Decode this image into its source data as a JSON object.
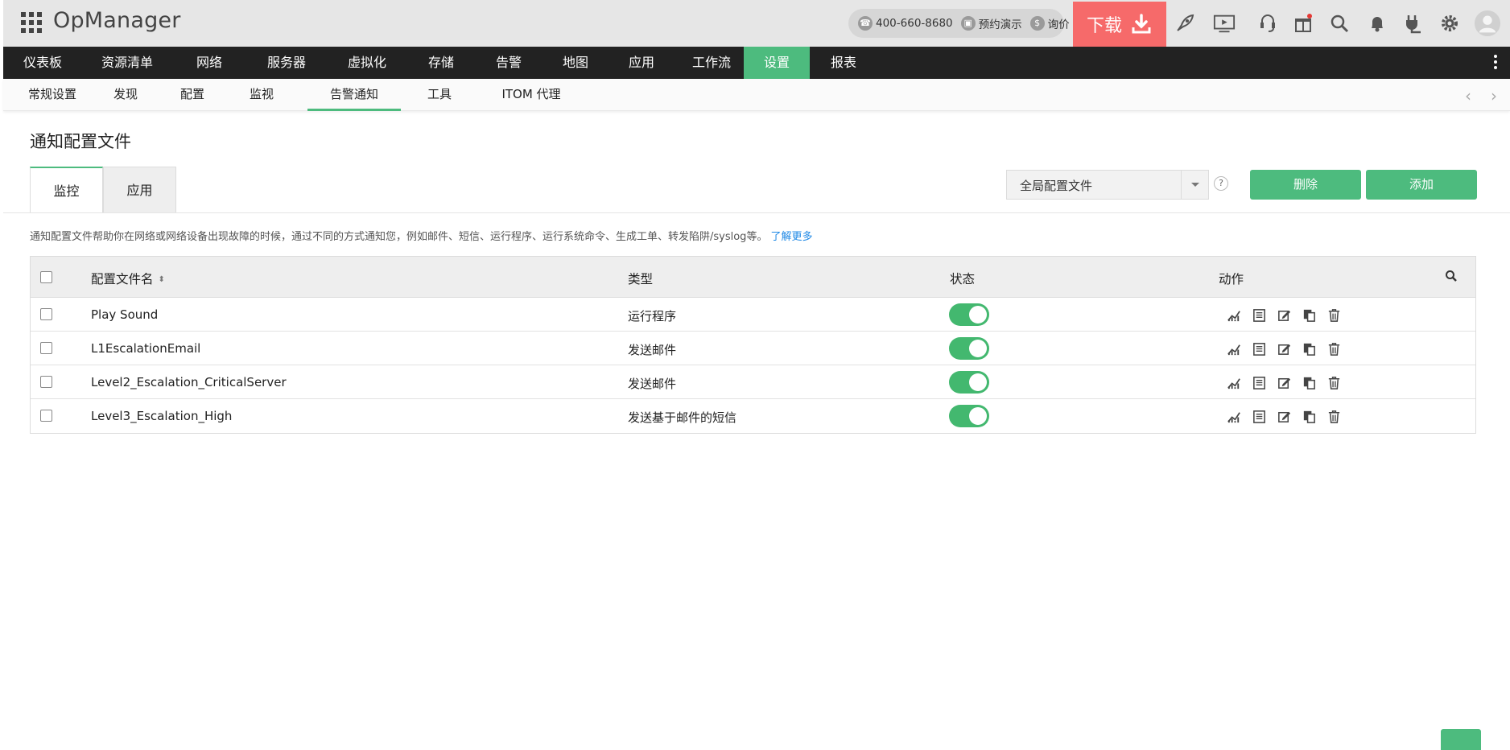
{
  "header": {
    "app_name": "OpManager",
    "phone": "400-660-8680",
    "demo_label": "预约演示",
    "quote_label": "询价",
    "download_label": "下载",
    "icons": [
      "rocket-icon",
      "presentation-icon",
      "support-icon",
      "gift-icon",
      "search-icon",
      "bell-icon",
      "plug-icon",
      "gear-icon",
      "user-avatar-icon"
    ]
  },
  "main_nav": {
    "items": [
      {
        "label": "仪表板"
      },
      {
        "label": "资源清单"
      },
      {
        "label": "网络"
      },
      {
        "label": "服务器"
      },
      {
        "label": "虚拟化"
      },
      {
        "label": "存储"
      },
      {
        "label": "告警"
      },
      {
        "label": "地图"
      },
      {
        "label": "应用"
      },
      {
        "label": "工作流"
      },
      {
        "label": "设置"
      },
      {
        "label": "报表"
      }
    ],
    "active_index": 10
  },
  "sub_nav": {
    "items": [
      {
        "label": "常规设置"
      },
      {
        "label": "发现"
      },
      {
        "label": "配置"
      },
      {
        "label": "监视"
      },
      {
        "label": "告警通知"
      },
      {
        "label": "工具"
      },
      {
        "label": "ITOM 代理"
      }
    ],
    "active_index": 4
  },
  "page": {
    "title": "通知配置文件",
    "tabs": [
      {
        "label": "监控"
      },
      {
        "label": "应用"
      }
    ],
    "active_tab": 0,
    "profile_filter": "全局配置文件",
    "help_label": "?",
    "delete_label": "删除",
    "add_label": "添加",
    "description": "通知配置文件帮助你在网络或网络设备出现故障的时候，通过不同的方式通知您，例如邮件、短信、运行程序、运行系统命令、生成工单、转发陷阱/syslog等。",
    "learn_more": "了解更多"
  },
  "table": {
    "columns": {
      "name": "配置文件名",
      "type": "类型",
      "status": "状态",
      "action": "动作"
    },
    "rows": [
      {
        "name": "Play Sound",
        "type": "运行程序",
        "enabled": true
      },
      {
        "name": "L1EscalationEmail",
        "type": "发送邮件",
        "enabled": true
      },
      {
        "name": "Level2_Escalation_CriticalServer",
        "type": "发送邮件",
        "enabled": true
      },
      {
        "name": "Level3_Escalation_High",
        "type": "发送基于邮件的短信",
        "enabled": true
      }
    ],
    "row_actions": [
      "report-chart-icon",
      "details-icon",
      "edit-icon",
      "copy-icon",
      "delete-icon"
    ]
  },
  "colors": {
    "accent_green": "#4dbb7e",
    "download_red": "#f66a6a",
    "nav_dark": "#222222",
    "link_blue": "#1e88e5"
  }
}
